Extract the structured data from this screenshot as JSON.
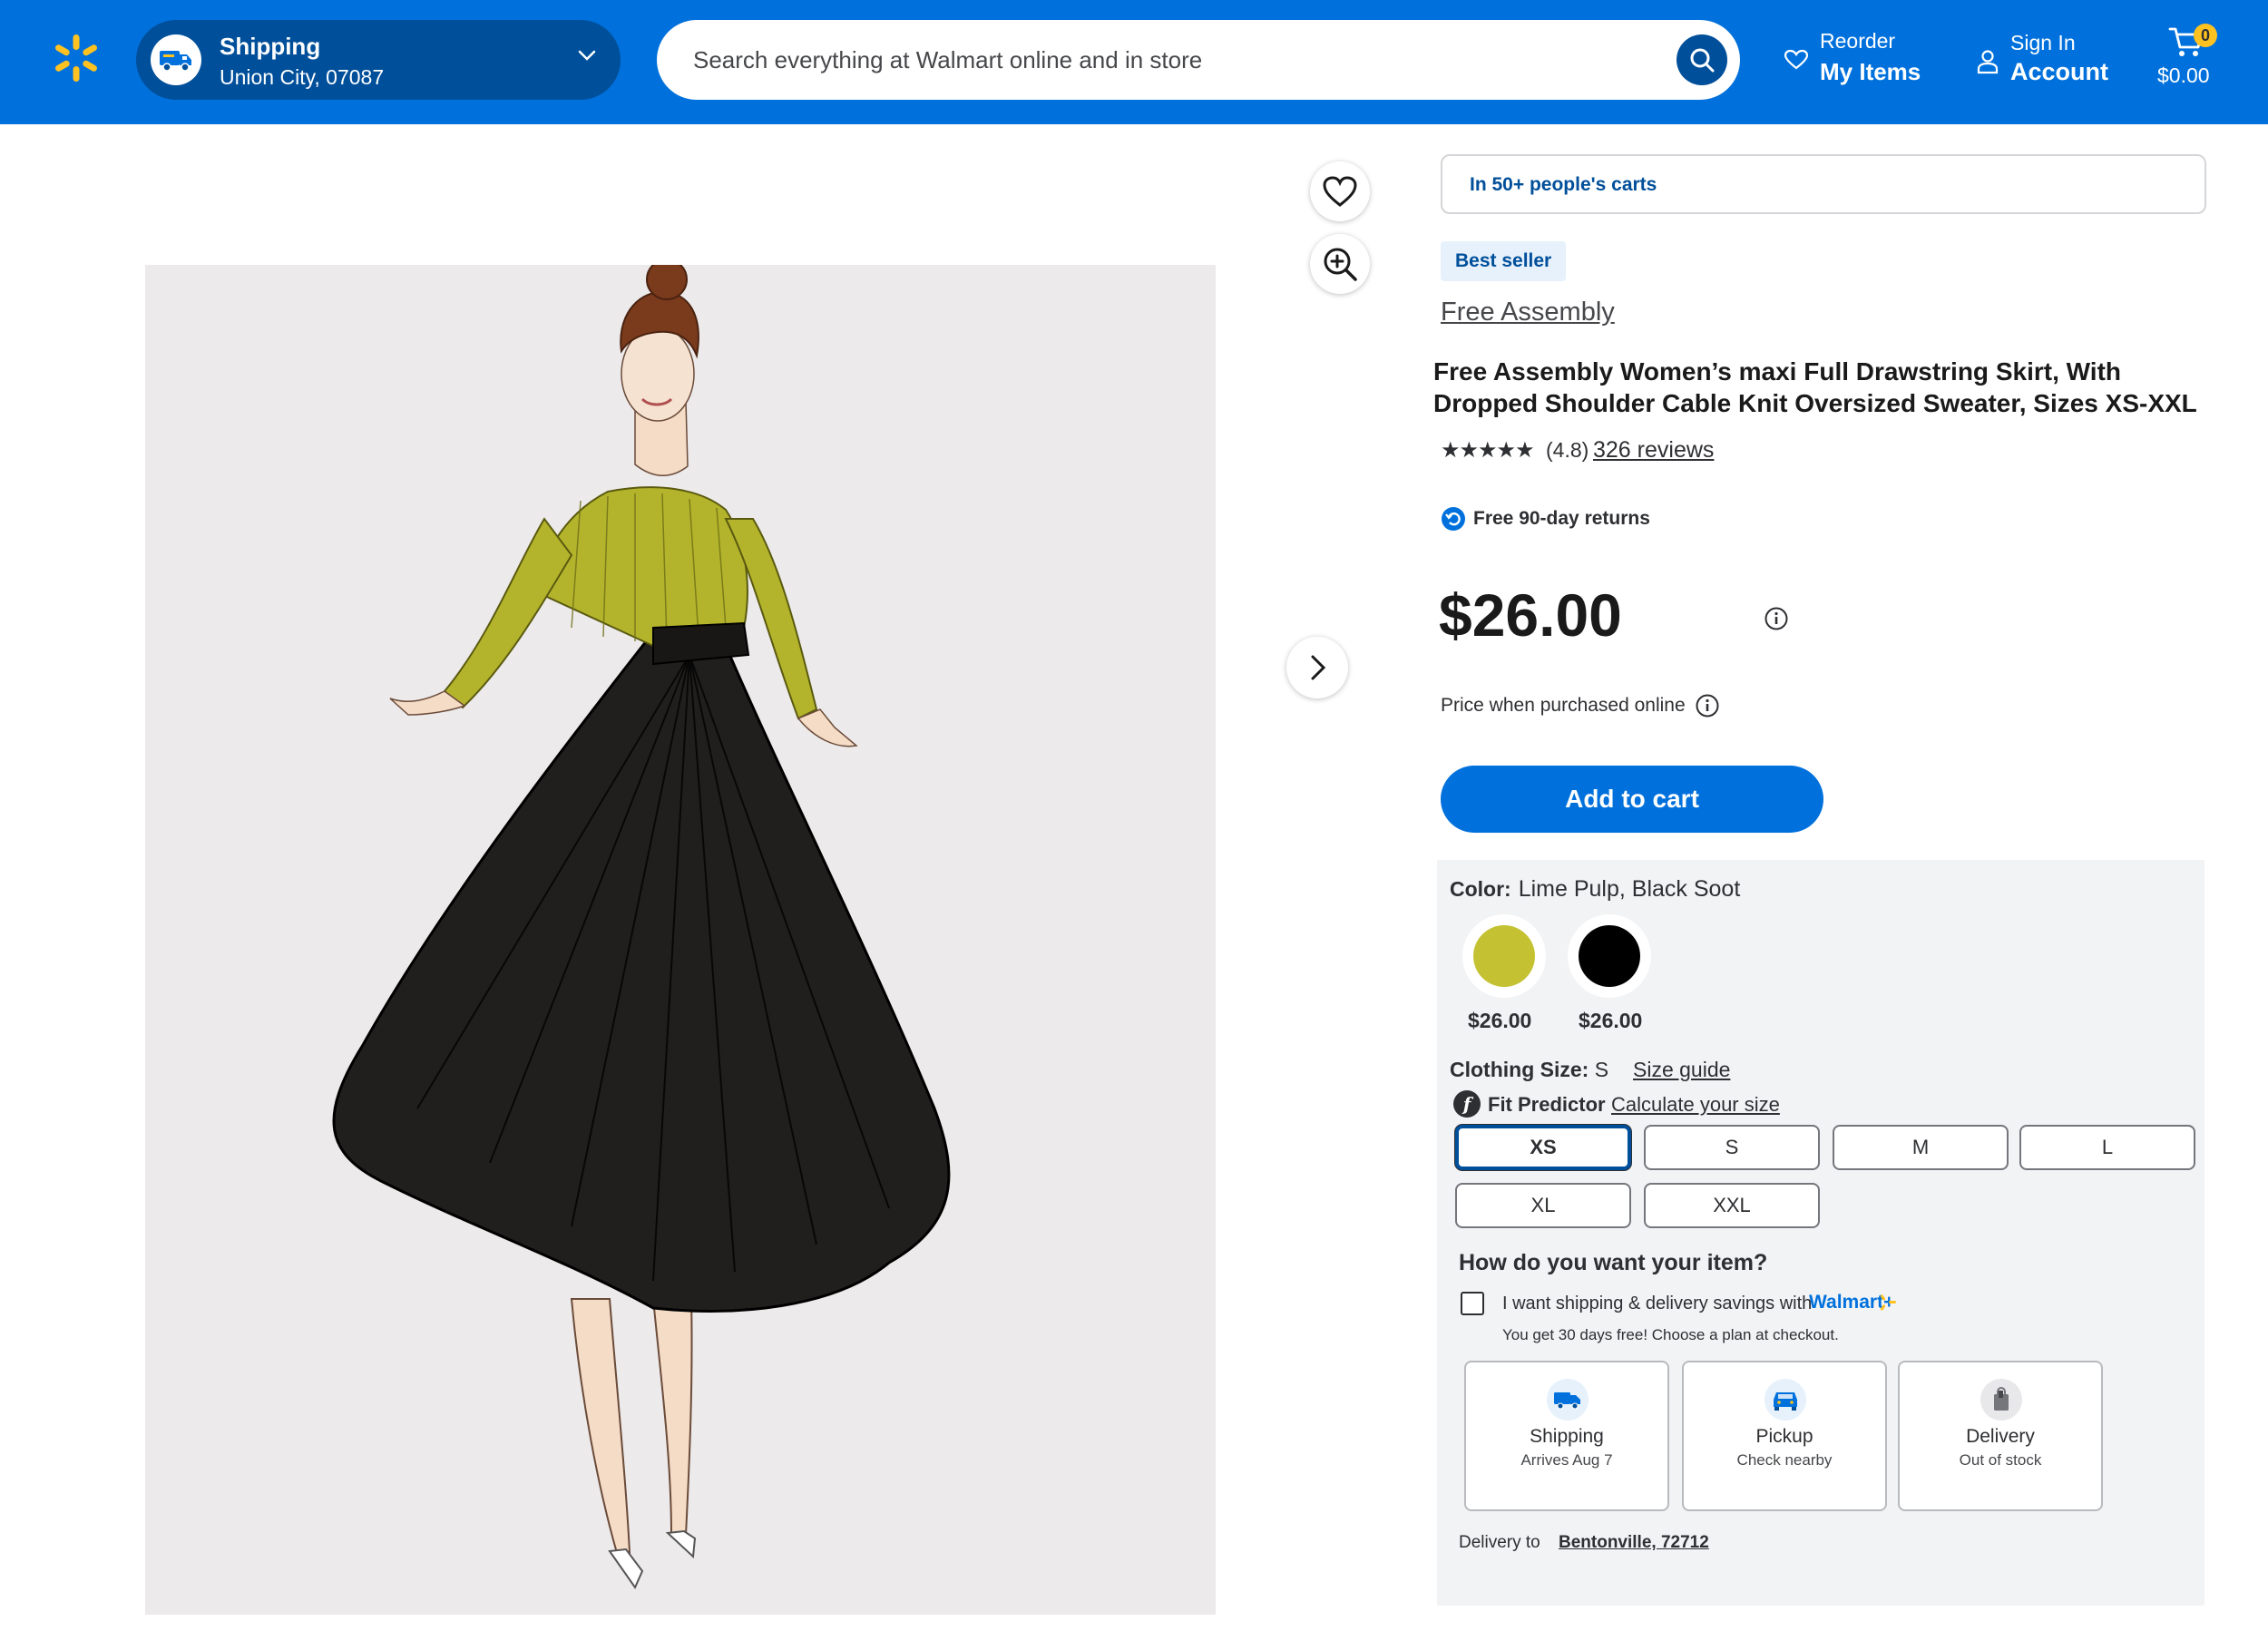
{
  "header": {
    "shipping": {
      "title": "Shipping",
      "location": "Union City, 07087"
    },
    "search": {
      "placeholder": "Search everything at Walmart online and in store"
    },
    "reorder": {
      "top": "Reorder",
      "bottom": "My Items"
    },
    "account": {
      "top": "Sign In",
      "bottom": "Account"
    },
    "cart": {
      "count": "0",
      "total": "$0.00"
    },
    "colors": {
      "bar": "#0071dc",
      "pill": "#004f9a",
      "spark": "#ffc220"
    }
  },
  "product": {
    "social_proof": "In 50+ people's carts",
    "badge": "Best seller",
    "brand": "Free Assembly",
    "title": "Free Assembly Women’s maxi Full Drawstring Skirt, With Dropped Shoulder Cable Knit Oversized Sweater, Sizes XS-XXL",
    "rating": {
      "stars": "★★★★★",
      "score": "(4.8)",
      "reviews": "326 reviews"
    },
    "returns": "Free 90-day returns",
    "price": "$26.00",
    "price_note": "Price when purchased online",
    "add_to_cart": "Add to cart"
  },
  "options": {
    "color_label": "Color:",
    "color_value": "Lime Pulp, Black Soot",
    "swatches": [
      {
        "name": "Lime Pulp",
        "color": "#c4c233",
        "price": "$26.00"
      },
      {
        "name": "Black Soot",
        "color": "#000000",
        "price": "$26.00"
      }
    ],
    "size_label": "Clothing Size:",
    "size_value": "S",
    "size_guide": "Size guide",
    "fit_predictor": "Fit Predictor",
    "fit_link": "Calculate your size",
    "sizes": [
      "XS",
      "S",
      "M",
      "L",
      "XL",
      "XXL"
    ],
    "selected_size": "XS"
  },
  "fulfillment": {
    "title": "How do you want your item?",
    "wplus_text": "I want shipping & delivery savings with",
    "wplus_brand": "Walmart+",
    "wplus_sub": "You get 30 days free! Choose a plan at checkout.",
    "cards": [
      {
        "label": "Shipping",
        "sub": "Arrives Aug 7",
        "icon": "truck-icon"
      },
      {
        "label": "Pickup",
        "sub": "Check nearby",
        "icon": "car-icon"
      },
      {
        "label": "Delivery",
        "sub": "Out of stock",
        "icon": "bag-icon"
      }
    ],
    "delivery_to_label": "Delivery to",
    "delivery_to_value": "Bentonville, 72712"
  }
}
